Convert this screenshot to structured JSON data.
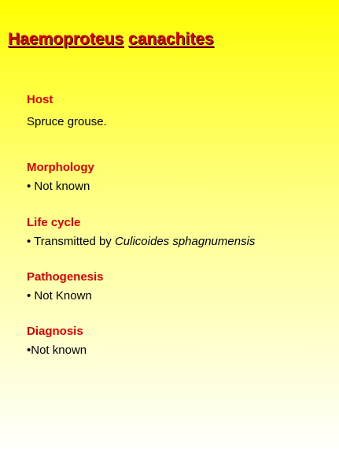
{
  "title": {
    "genus": "Haemoproteus",
    "species": "canachites"
  },
  "sections": {
    "host": {
      "heading": "Host",
      "text": "Spruce grouse."
    },
    "morphology": {
      "heading": "Morphology",
      "text": "• Not known"
    },
    "life_cycle": {
      "heading": "Life cycle",
      "text_prefix": "• Transmitted by ",
      "vector": "Culicoides sphagnumensis"
    },
    "pathogenesis": {
      "heading": "Pathogenesis",
      "text": "• Not Known"
    },
    "diagnosis": {
      "heading": "Diagnosis",
      "text": "•Not known"
    }
  },
  "colors": {
    "heading": "#e00000",
    "background_top": "#ffff00",
    "background_bottom": "#ffffff"
  }
}
